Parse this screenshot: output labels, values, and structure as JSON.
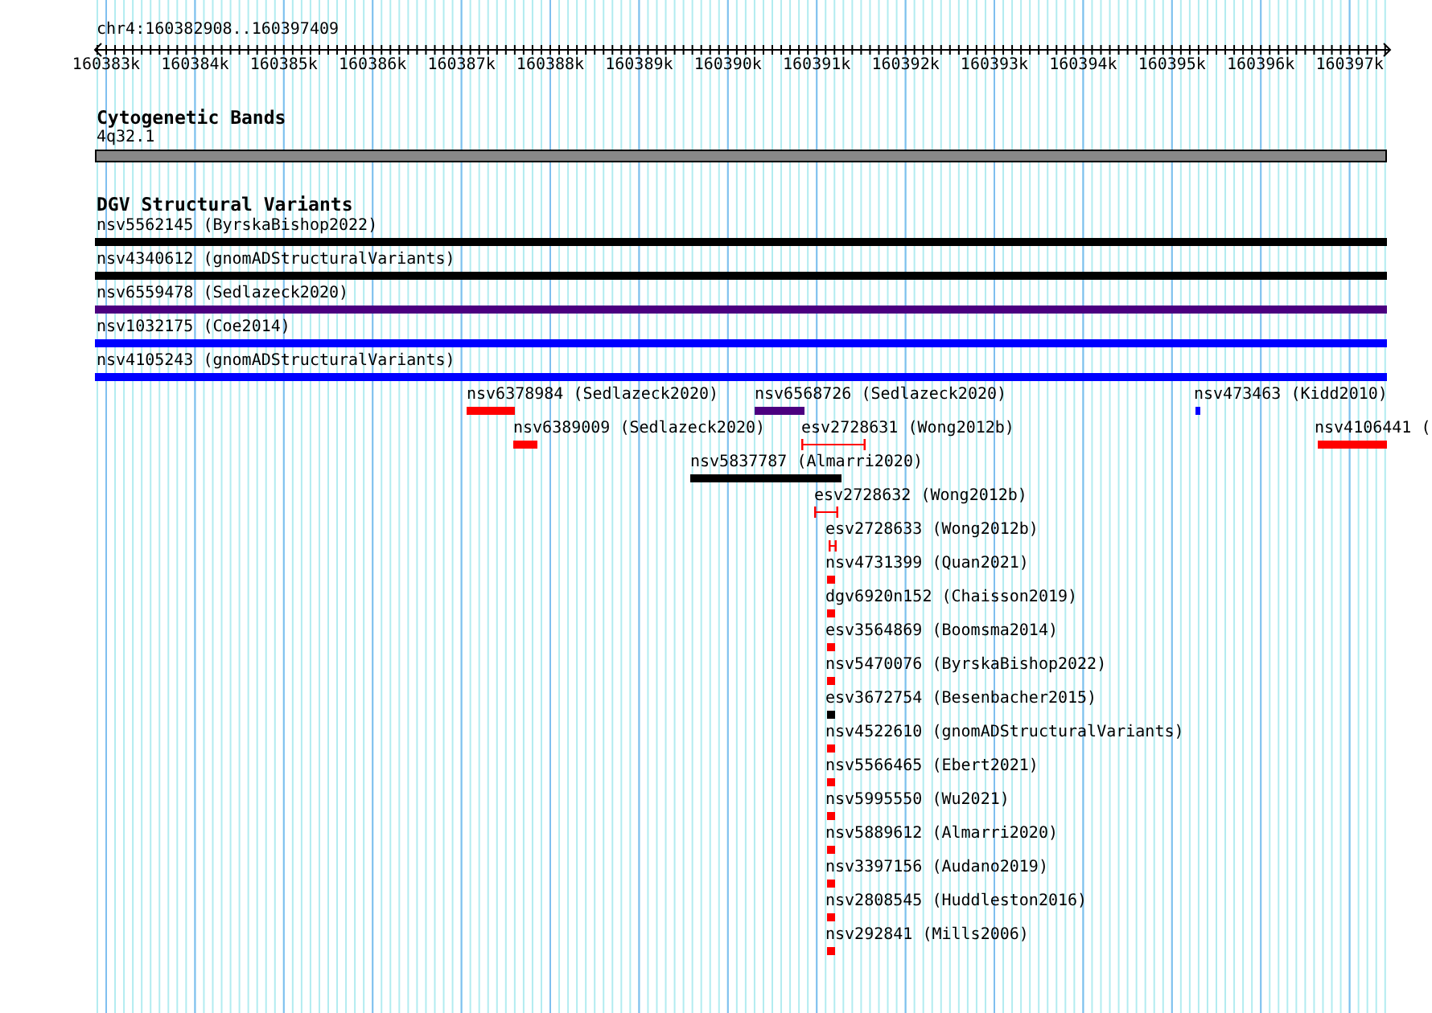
{
  "ruler": {
    "location": "chr4:160382908..160397409",
    "ticks": [
      "160383k",
      "160384k",
      "160385k",
      "160386k",
      "160387k",
      "160388k",
      "160389k",
      "160390k",
      "160391k",
      "160392k",
      "160393k",
      "160394k",
      "160395k",
      "160396k",
      "160397k"
    ]
  },
  "tracks": [
    {
      "title": "Cytogenetic Bands",
      "kind": "bands",
      "features": [
        {
          "label": "4q32.1",
          "color": "#888888",
          "kind": "band"
        }
      ]
    },
    {
      "title": "DGV Structural Variants",
      "kind": "variants",
      "features": [
        {
          "label": "nsv5562145 (ByrskaBishop2022)",
          "color": "#000000",
          "kind": "bar"
        },
        {
          "label": "nsv4340612 (gnomADStructuralVariants)",
          "color": "#000000",
          "kind": "bar"
        },
        {
          "label": "nsv6559478 (Sedlazeck2020)",
          "color": "#4b0080",
          "kind": "bar"
        },
        {
          "label": "nsv1032175 (Coe2014)",
          "color": "#0000ff",
          "kind": "bar"
        },
        {
          "label": "nsv4105243 (gnomADStructuralVariants)",
          "color": "#0000ff",
          "kind": "bar"
        },
        {
          "label": "nsv6378984 (Sedlazeck2020)",
          "color": "#ff0000",
          "kind": "bar"
        },
        {
          "label": "nsv6568726 (Sedlazeck2020)",
          "color": "#4b0080",
          "kind": "bar"
        },
        {
          "label": "nsv473463 (Kidd2010)",
          "color": "#0000ff",
          "kind": "bar"
        },
        {
          "label": "nsv6389009 (Sedlazeck2020)",
          "color": "#ff0000",
          "kind": "bar"
        },
        {
          "label": "esv2728631 (Wong2012b)",
          "color": "#ff0000",
          "kind": "span"
        },
        {
          "label": "nsv4106441 (",
          "color": "#ff0000",
          "kind": "bar"
        },
        {
          "label": "nsv5837787 (Almarri2020)",
          "color": "#000000",
          "kind": "bar"
        },
        {
          "label": "esv2728632 (Wong2012b)",
          "color": "#ff0000",
          "kind": "span"
        },
        {
          "label": "esv2728633 (Wong2012b)",
          "color": "#ff0000",
          "kind": "span"
        },
        {
          "label": "nsv4731399 (Quan2021)",
          "color": "#ff0000",
          "kind": "bar"
        },
        {
          "label": "dgv6920n152 (Chaisson2019)",
          "color": "#ff0000",
          "kind": "bar"
        },
        {
          "label": "esv3564869 (Boomsma2014)",
          "color": "#ff0000",
          "kind": "bar"
        },
        {
          "label": "nsv5470076 (ByrskaBishop2022)",
          "color": "#ff0000",
          "kind": "bar"
        },
        {
          "label": "esv3672754 (Besenbacher2015)",
          "color": "#000000",
          "kind": "bar"
        },
        {
          "label": "nsv4522610 (gnomADStructuralVariants)",
          "color": "#ff0000",
          "kind": "bar"
        },
        {
          "label": "nsv5566465 (Ebert2021)",
          "color": "#ff0000",
          "kind": "bar"
        },
        {
          "label": "nsv5995550 (Wu2021)",
          "color": "#ff0000",
          "kind": "bar"
        },
        {
          "label": "nsv5889612 (Almarri2020)",
          "color": "#ff0000",
          "kind": "bar"
        },
        {
          "label": "nsv3397156 (Audano2019)",
          "color": "#ff0000",
          "kind": "bar"
        },
        {
          "label": "nsv2808545 (Huddleston2016)",
          "color": "#ff0000",
          "kind": "bar"
        },
        {
          "label": "nsv292841 (Mills2006)",
          "color": "#ff0000",
          "kind": "bar"
        }
      ]
    }
  ]
}
